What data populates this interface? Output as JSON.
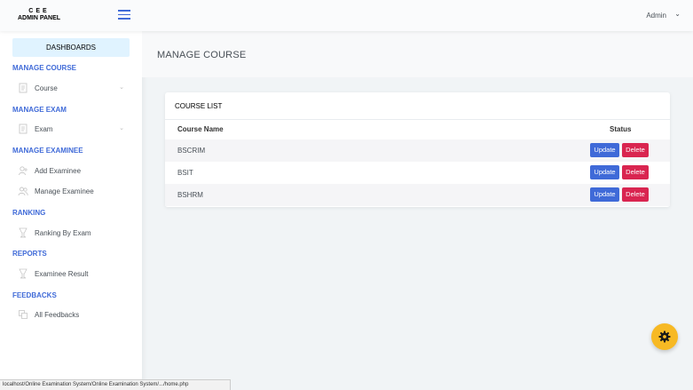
{
  "header": {
    "logo_line1": "CEE",
    "logo_line2": "ADMIN PANEL",
    "user_label": "Admin",
    "user_chevron": "⌄"
  },
  "sidebar": {
    "dashboards": "DASHBOARDS",
    "sections": [
      {
        "title": "MANAGE COURSE",
        "items": [
          {
            "label": "Course",
            "icon": "document-icon",
            "has_chevron": true
          }
        ]
      },
      {
        "title": "MANAGE EXAM",
        "items": [
          {
            "label": "Exam",
            "icon": "document-icon",
            "has_chevron": true
          }
        ]
      },
      {
        "title": "MANAGE EXAMINEE",
        "items": [
          {
            "label": "Add Examinee",
            "icon": "add-user-icon"
          },
          {
            "label": "Manage Examinee",
            "icon": "users-icon"
          }
        ]
      },
      {
        "title": "RANKING",
        "items": [
          {
            "label": "Ranking By Exam",
            "icon": "trophy-icon"
          }
        ]
      },
      {
        "title": "REPORTS",
        "items": [
          {
            "label": "Examinee Result",
            "icon": "trophy-icon"
          }
        ]
      },
      {
        "title": "FEEDBACKS",
        "items": [
          {
            "label": "All Feedbacks",
            "icon": "copy-icon"
          }
        ]
      }
    ],
    "chevron": "⌄"
  },
  "main": {
    "page_title": "MANAGE COURSE",
    "card_title": "COURSE LIST",
    "columns": [
      "Course Name",
      "Status"
    ],
    "rows": [
      {
        "name": "BSCRIM",
        "update": "Update",
        "delete": "Delete"
      },
      {
        "name": "BSIT",
        "update": "Update",
        "delete": "Delete"
      },
      {
        "name": "BSHRM",
        "update": "Update",
        "delete": "Delete"
      }
    ]
  },
  "status_bar": {
    "url": "localhost/Online Examination System/Online Examination System/.../home.php"
  },
  "colors": {
    "primary": "#3f6ad8",
    "danger": "#d92550",
    "warning": "#f7b924",
    "dashboard_active_bg": "#e0f3ff"
  }
}
